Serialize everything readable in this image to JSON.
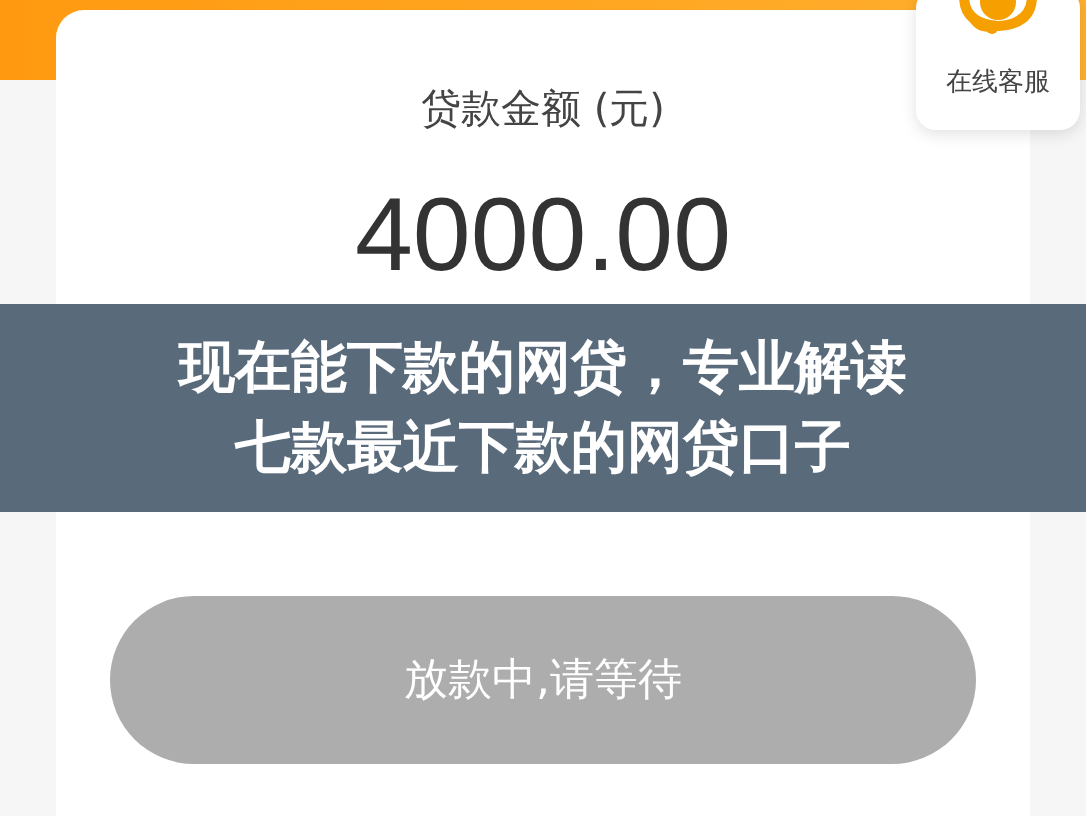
{
  "loan_card": {
    "label": "贷款金额 (元)",
    "amount": "4000.00",
    "button": {
      "label": "放款中,请等待",
      "disabled": true
    }
  },
  "service": {
    "label": "在线客服"
  },
  "overlay_title": [
    "现在能下款的网贷，专业解读",
    "七款最近下款的网贷口子"
  ]
}
